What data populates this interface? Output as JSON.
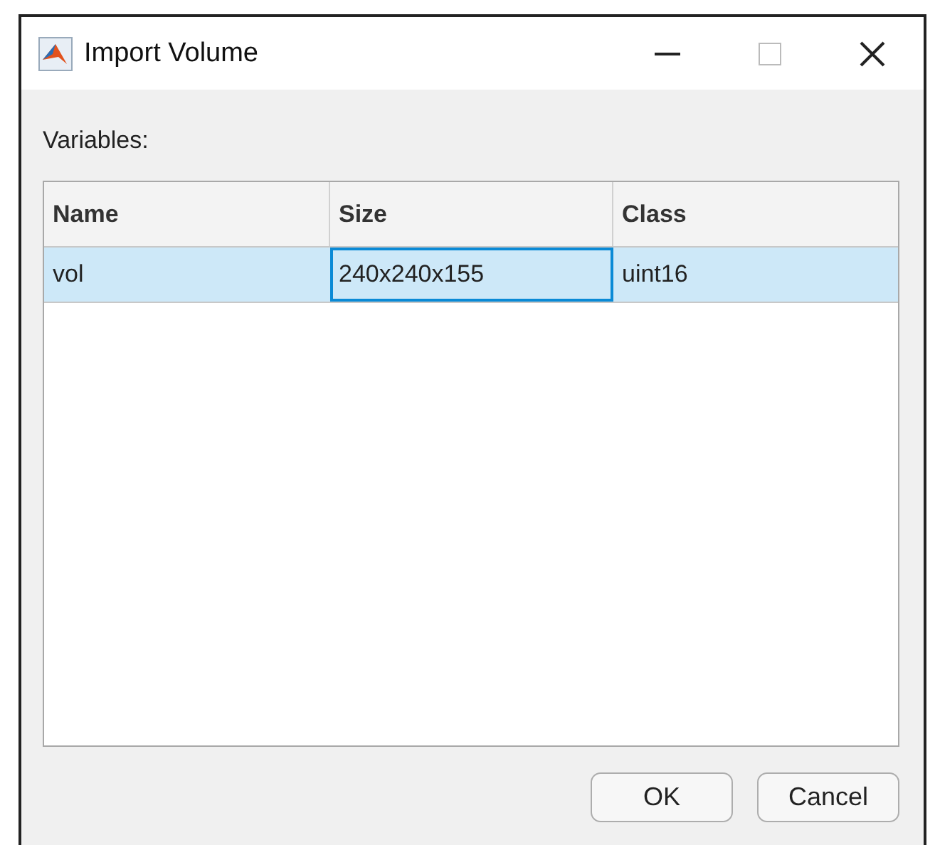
{
  "window": {
    "title": "Import Volume"
  },
  "variables_label": "Variables:",
  "table": {
    "columns": [
      "Name",
      "Size",
      "Class"
    ],
    "rows": [
      {
        "selected": true,
        "cells": [
          {
            "text": "vol",
            "focused": false
          },
          {
            "text": "240x240x155",
            "focused": true
          },
          {
            "text": "uint16",
            "focused": false
          }
        ]
      }
    ]
  },
  "buttons": [
    "OK",
    "Cancel"
  ]
}
